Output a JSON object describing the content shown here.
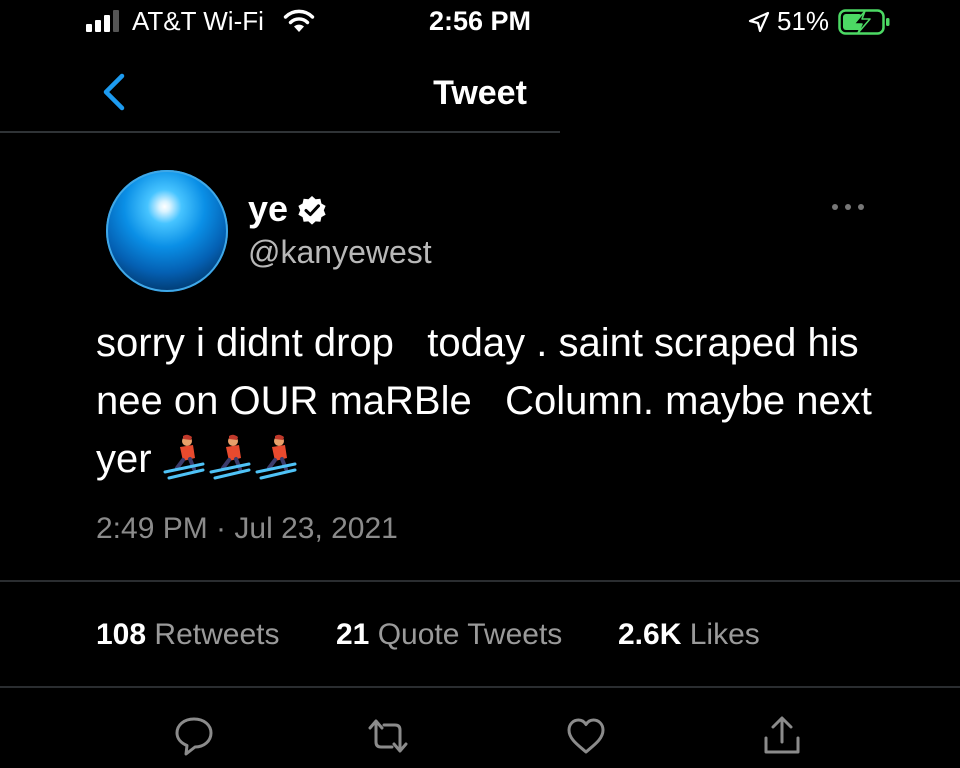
{
  "status_bar": {
    "carrier": "AT&T Wi-Fi",
    "time": "2:56 PM",
    "battery_percent": "51%"
  },
  "nav": {
    "title": "Tweet"
  },
  "tweet": {
    "display_name": "ye",
    "handle": "@kanyewest",
    "text": "sorry i didnt drop   today . saint scraped his nee on OUR maRBle   Column. maybe next yer ",
    "emoji": [
      "skier",
      "skier",
      "skier"
    ],
    "timestamp": "2:49 PM · Jul 23, 2021"
  },
  "stats": {
    "retweets_count": "108",
    "retweets_label": "Retweets",
    "quotes_count": "21",
    "quotes_label": "Quote Tweets",
    "likes_count": "2.6K",
    "likes_label": "Likes"
  },
  "actions": [
    "reply-icon",
    "retweet-icon",
    "like-icon",
    "share-icon"
  ],
  "colors": {
    "background": "#000000",
    "accent": "#1d9bf0",
    "battery_charging": "#4cd964",
    "secondary_text": "#8b8b8b"
  }
}
